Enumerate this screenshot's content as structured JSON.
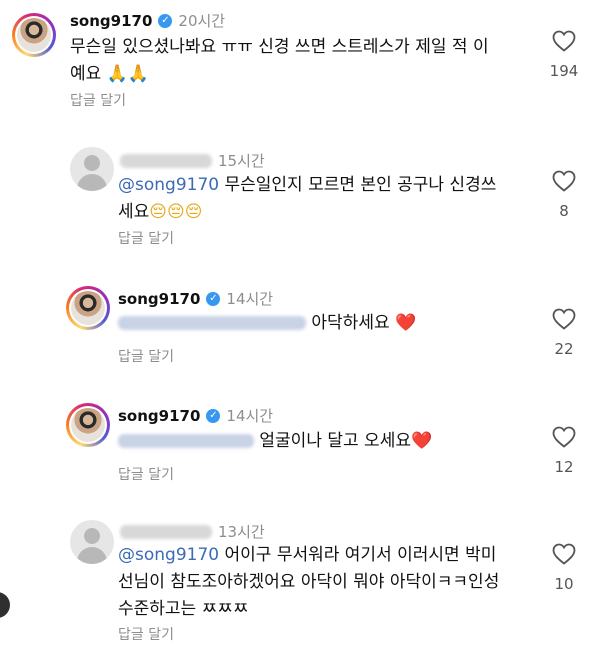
{
  "comments": [
    {
      "username": "song9170",
      "time": "20시간",
      "text": "무슨일 있으셨나봐요 ㅠㅠ 신경 쓰면 스트레스가 제일 적 이",
      "text_line2": "예요",
      "emoji": "🙏🙏",
      "reply_label": "답글 달기",
      "likes": "194"
    },
    {
      "time": "15시간",
      "mention": "@song9170",
      "text": "무슨일인지 모르면 본인 공구나 신경쓰",
      "text_line2": "세요",
      "emoji": "😔😔😔",
      "reply_label": "답글 달기",
      "likes": "8"
    },
    {
      "username": "song9170",
      "time": "14시간",
      "text": "아닥하세요",
      "emoji": "❤️",
      "reply_label": "답글 달기",
      "likes": "22"
    },
    {
      "username": "song9170",
      "time": "14시간",
      "text": "얼굴이나 달고 오세요",
      "emoji": "❤️",
      "reply_label": "답글 달기",
      "likes": "12"
    },
    {
      "time": "13시간",
      "mention": "@song9170",
      "text": "어이구 무서워라 여기서 이러시면 박미",
      "text_line2": "선님이 참도조아하겠어요 아닥이 뭐야 아닥이ㅋㅋ인성",
      "text_line3": "수준하고는 ㅉㅉㅉ",
      "reply_label": "답글 달기",
      "likes": "10"
    }
  ],
  "icons": {
    "like": "heart-icon",
    "verified": "verified-badge-icon"
  },
  "colors": {
    "mention": "#3b6bb5",
    "verified": "#3897f0",
    "secondary_text": "#8e8e8e"
  }
}
